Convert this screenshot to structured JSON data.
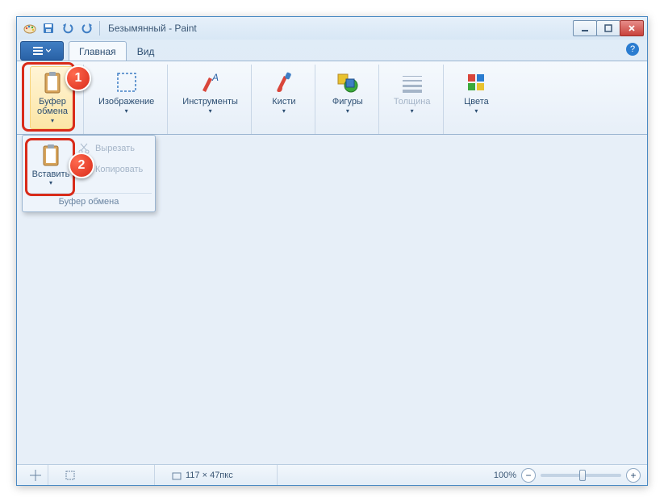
{
  "title": "Безымянный - Paint",
  "tabs": {
    "home": "Главная",
    "view": "Вид"
  },
  "ribbon": {
    "clipboard": "Буфер\nобмена",
    "image": "Изображение",
    "tools": "Инструменты",
    "brushes": "Кисти",
    "shapes": "Фигуры",
    "stroke": "Толщина",
    "colors": "Цвета"
  },
  "dropdown": {
    "paste": "Вставить",
    "cut": "Вырезать",
    "copy": "Копировать",
    "caption": "Буфер обмена"
  },
  "status": {
    "dimensions": "117 × 47пкс",
    "zoom": "100%"
  },
  "markers": {
    "m1": "1",
    "m2": "2"
  }
}
